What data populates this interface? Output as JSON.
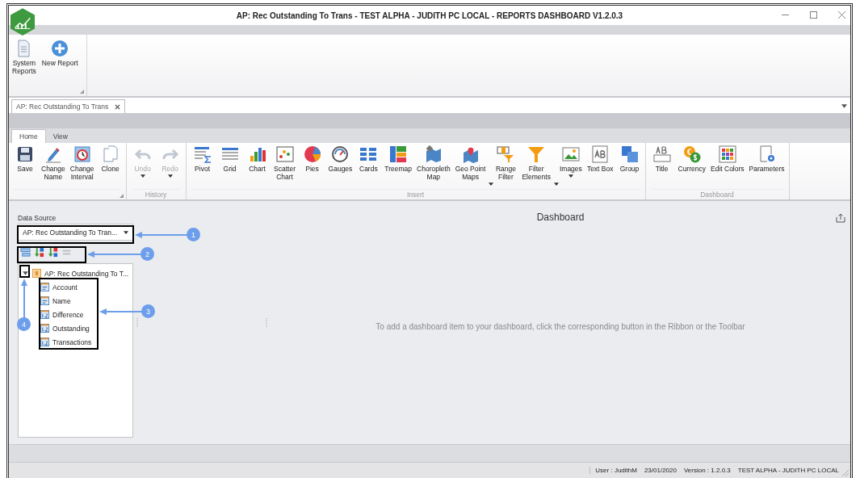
{
  "window": {
    "title": "AP: Rec Outstanding To Trans - TEST ALPHA - JUDITH PC LOCAL - REPORTS DASHBOARD V1.2.0.3"
  },
  "quick_bar": {
    "buttons": [
      {
        "label": "System\nReports"
      },
      {
        "label": "New Report"
      }
    ]
  },
  "document_tabs": [
    {
      "label": "AP: Rec Outstanding To Trans"
    }
  ],
  "ribbon_tabs": [
    {
      "label": "Home",
      "selected": true
    },
    {
      "label": "View",
      "selected": false
    }
  ],
  "ribbon_groups": [
    {
      "launcher": true,
      "buttons": [
        {
          "label": "Save",
          "disabled": false,
          "dropdown": false
        },
        {
          "label": "Change\nName",
          "disabled": false,
          "dropdown": false
        },
        {
          "label": "Change\nInterval",
          "disabled": false,
          "dropdown": false
        },
        {
          "label": "Clone",
          "disabled": false,
          "dropdown": false
        }
      ]
    },
    {
      "label": "History",
      "launcher": false,
      "buttons": [
        {
          "label": "Undo",
          "disabled": true,
          "dropdown": true
        },
        {
          "label": "Redo",
          "disabled": true,
          "dropdown": true
        }
      ]
    },
    {
      "label": "Insert",
      "launcher": false,
      "buttons": [
        {
          "label": "Pivot",
          "disabled": false,
          "dropdown": false
        },
        {
          "label": "Grid",
          "disabled": false,
          "dropdown": false
        },
        {
          "label": "Chart",
          "disabled": false,
          "dropdown": false
        },
        {
          "label": "Scatter\nChart",
          "disabled": false,
          "dropdown": false
        },
        {
          "label": "Pies",
          "disabled": false,
          "dropdown": false
        },
        {
          "label": "Gauges",
          "disabled": false,
          "dropdown": false
        },
        {
          "label": "Cards",
          "disabled": false,
          "dropdown": false
        },
        {
          "label": "Treemap",
          "disabled": false,
          "dropdown": false
        },
        {
          "label": "Choropleth\nMap",
          "disabled": false,
          "dropdown": false
        },
        {
          "label": "Geo Point\nMaps",
          "disabled": false,
          "dropdown": true
        },
        {
          "label": "Range\nFilter",
          "disabled": false,
          "dropdown": false
        },
        {
          "label": "Filter\nElements",
          "disabled": false,
          "dropdown": true
        },
        {
          "label": "Images",
          "disabled": false,
          "dropdown": true
        },
        {
          "label": "Text Box",
          "disabled": false,
          "dropdown": false
        },
        {
          "label": "Group",
          "disabled": false,
          "dropdown": false
        }
      ]
    },
    {
      "label": "Dashboard",
      "launcher": false,
      "buttons": [
        {
          "label": "Title",
          "disabled": false,
          "dropdown": false
        },
        {
          "label": "Currency",
          "disabled": false,
          "dropdown": false
        },
        {
          "label": "Edit Colors",
          "disabled": false,
          "dropdown": false
        },
        {
          "label": "Parameters",
          "disabled": false,
          "dropdown": false
        }
      ]
    }
  ],
  "data_source": {
    "label": "Data Source",
    "value": "AP: Rec Outstanding To Tran..."
  },
  "field_tree": {
    "label": "AP: Rec Outstanding To T...",
    "expanded": true,
    "children": [
      {
        "label": "Account",
        "kind": "text"
      },
      {
        "label": "Name",
        "kind": "text"
      },
      {
        "label": "Difference",
        "kind": "number"
      },
      {
        "label": "Outstanding",
        "kind": "number"
      },
      {
        "label": "Transactions",
        "kind": "number"
      }
    ]
  },
  "dashboard": {
    "title": "Dashboard",
    "hint": "To add a dashboard item to your dashboard, click the corresponding button in the Ribbon or the Toolbar"
  },
  "annotations": [
    {
      "number": "1"
    },
    {
      "number": "2"
    },
    {
      "number": "3"
    },
    {
      "number": "4"
    }
  ],
  "status_bar": [
    "User : JudithM",
    "23/01/2020",
    "Version : 1.2.0.3",
    "TEST ALPHA - JUDITH PC LOCAL"
  ]
}
